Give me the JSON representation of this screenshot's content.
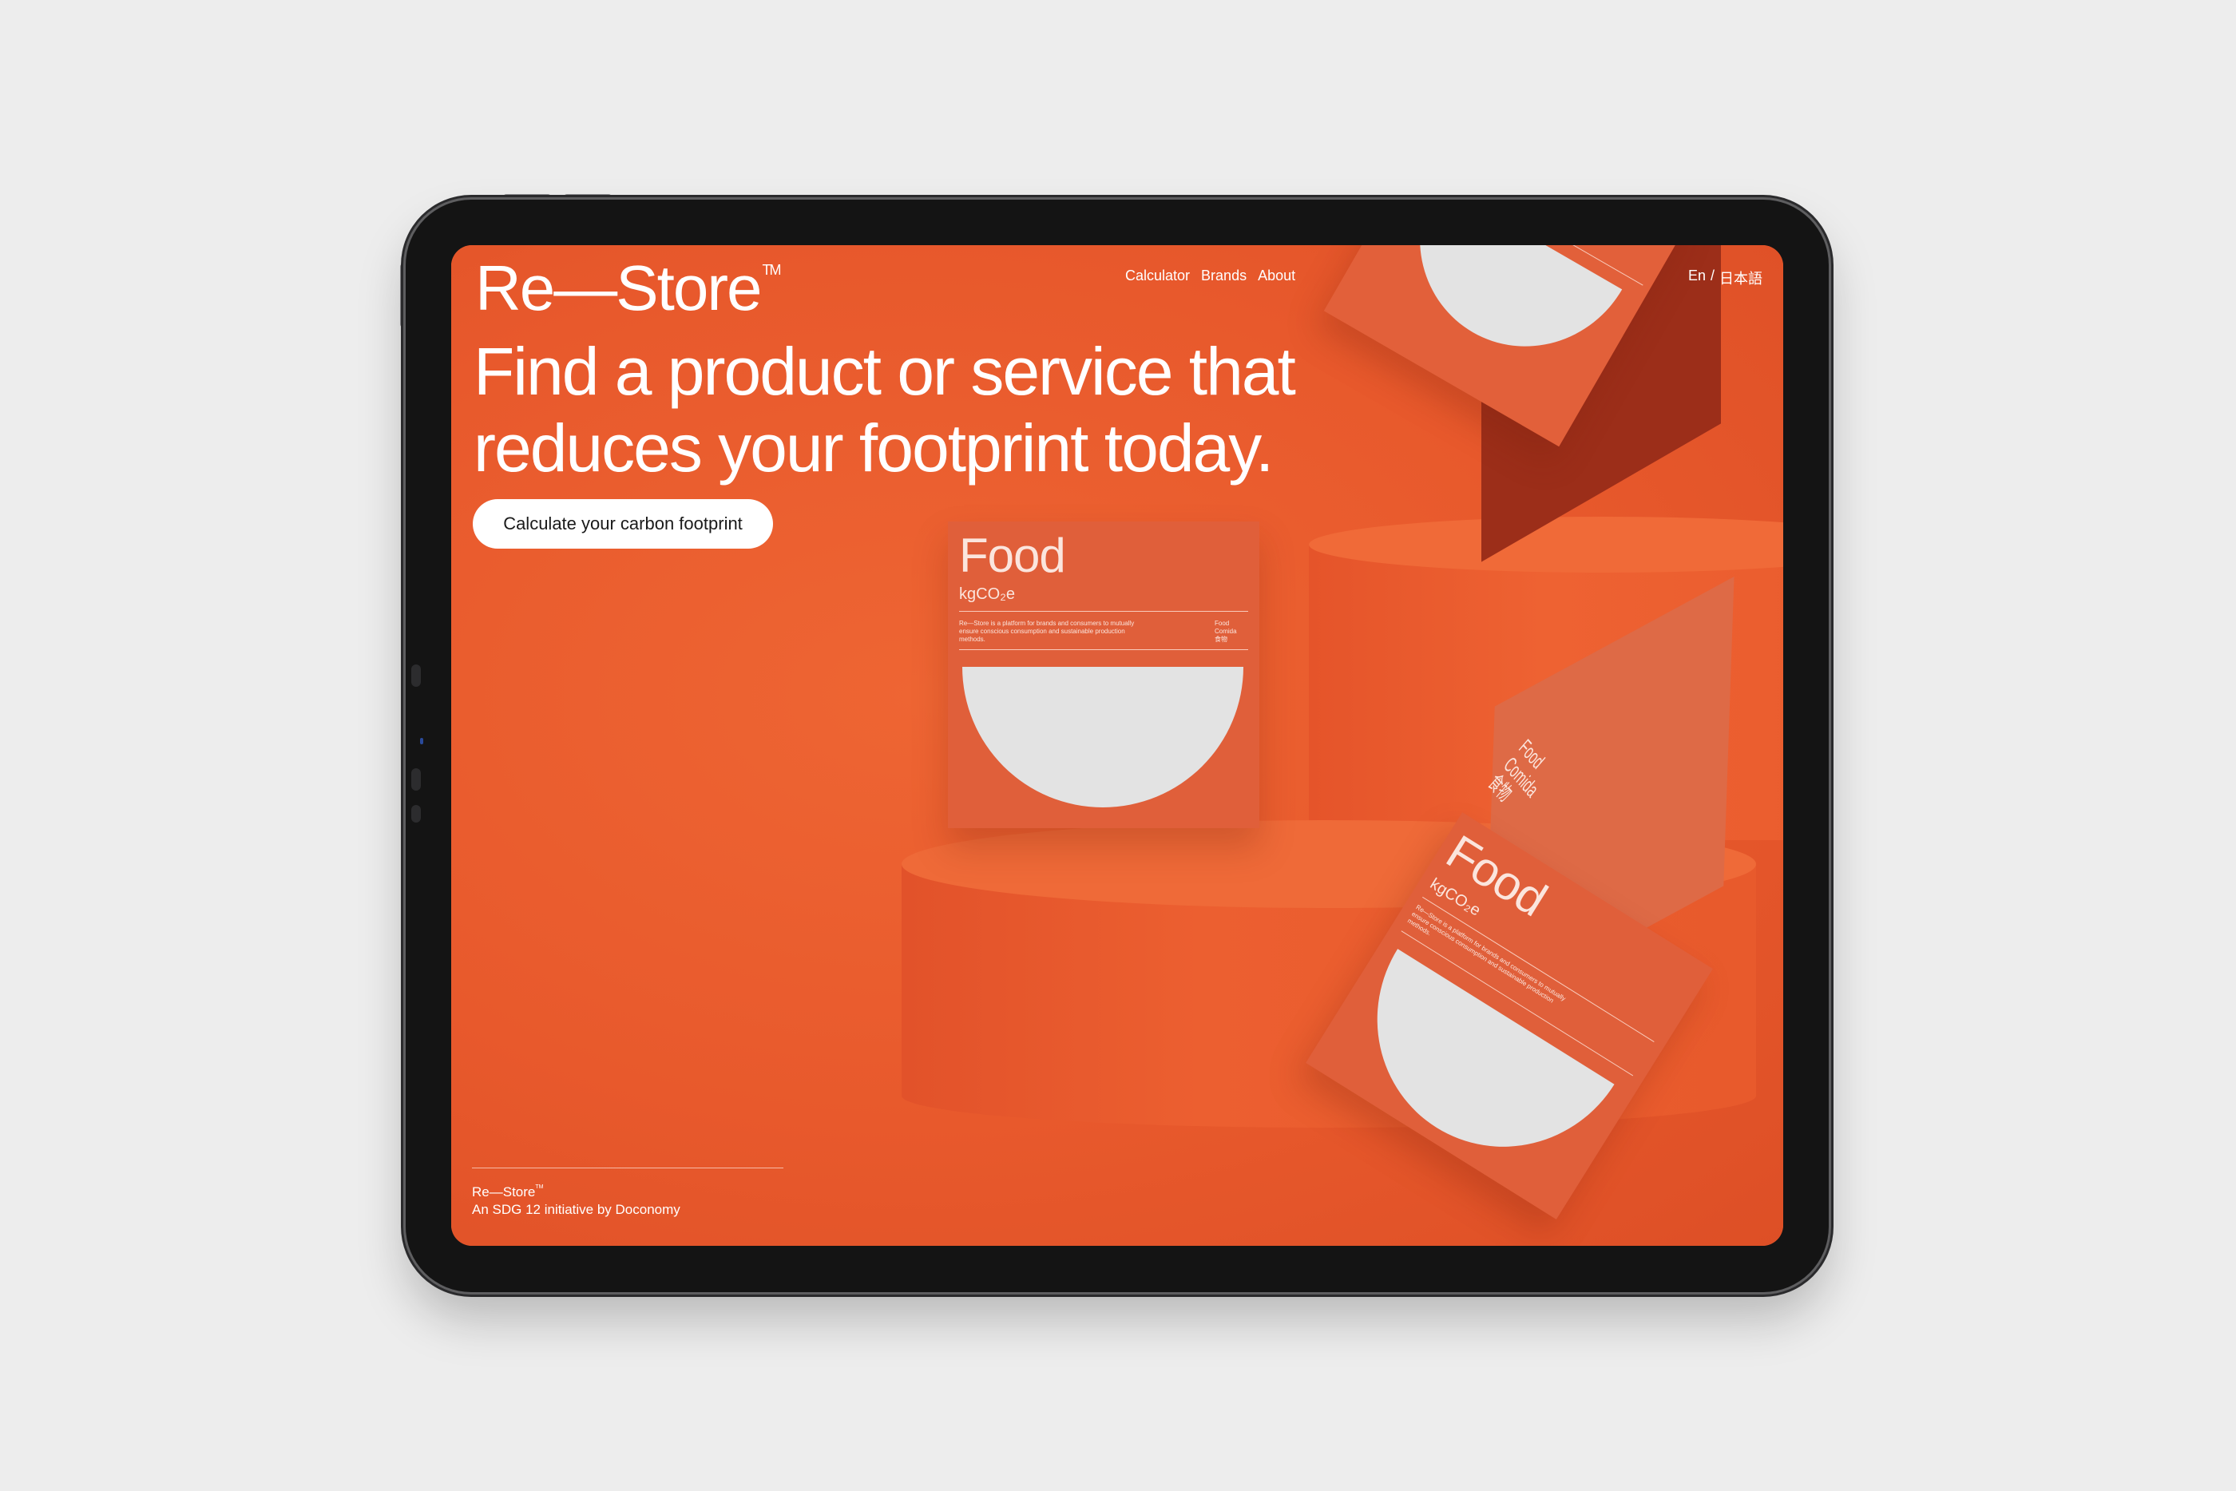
{
  "brand": {
    "logo": "Re—Store",
    "trademark": "TM"
  },
  "hero": {
    "headline": "Find a product or service that reduces your footprint today.",
    "cta_label": "Calculate your carbon footprint"
  },
  "nav": {
    "items": [
      "Calculator",
      "Brands",
      "About"
    ]
  },
  "language": {
    "en": "En",
    "separator": "/",
    "ja": "日本語"
  },
  "product_box": {
    "title": "Food",
    "unit": "kgCO₂e",
    "description": "Re—Store is a platform for brands and consumers to mutually ensure conscious consumption and sustainable production methods.",
    "side_labels": "Food\nComida\n食物"
  },
  "footer": {
    "logo": "Re—Store",
    "tagline": "An SDG 12 initiative by Doconomy"
  },
  "colors": {
    "accent": "#ea5c2e",
    "bezel": "#141414",
    "background": "#ededed"
  }
}
